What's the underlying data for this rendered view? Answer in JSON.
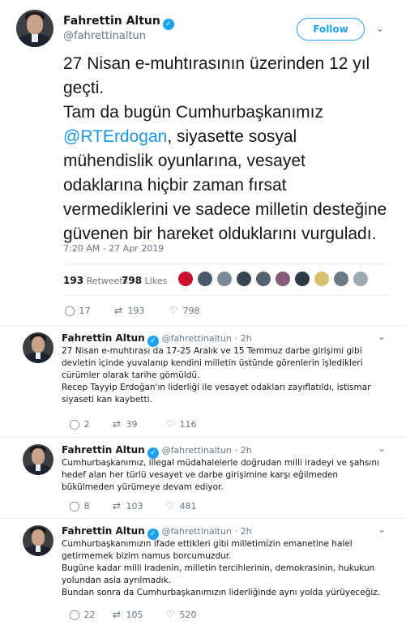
{
  "main_tweet": {
    "author_name": "Fahrettin Altun",
    "handle": "@fahrettinaltun",
    "follow_label": "Follow",
    "text_line1": "27 Nisan e-muhtırasının üzerinden 12 yıl geçti.",
    "text_line2_prefix": "Tam da bugün Cumhurbaşkanımız ",
    "mention": "@RTErdogan",
    "text_line2_suffix": ", siyasette sosyal mühendislik oyunlarına, vesayet odaklarına hiçbir zaman fırsat vermediklerini ve sadece milletin desteğine güvenen bir hareket olduklarını vurguladı.",
    "timestamp": "7:20 AM - 27 Apr 2019",
    "retweets_count": "193",
    "retweets_label": "Retweets",
    "likes_count": "798",
    "likes_label": "Likes",
    "replies": "17",
    "retweets": "193",
    "likes": "798"
  },
  "replies": [
    {
      "author_name": "Fahrettin Altun",
      "handle": "@fahrettinaltun",
      "time": "· 2h",
      "lines": [
        "27 Nisan e-muhtırası da 17-25 Aralık ve 15 Temmuz darbe girişimi gibi devletin içinde yuvalanıp kendini milletin üstünde görenlerin işledikleri cürümler olarak tarihe gömüldü.",
        "Recep Tayyip Erdoğan'ın liderliği ile vesayet odakları zayıflatıldı, istismar siyaseti kan kaybetti."
      ],
      "replies": "2",
      "retweets": "39",
      "likes": "116"
    },
    {
      "author_name": "Fahrettin Altun",
      "handle": "@fahrettinaltun",
      "time": "· 2h",
      "lines": [
        "Cumhurbaşkanımız, illegal müdahalelerle doğrudan milli iradeyi ve şahsını hedef alan her türlü vesayet ve darbe girişimine karşı eğilmeden bükülmeden yürümeye devam ediyor."
      ],
      "replies": "8",
      "retweets": "103",
      "likes": "481"
    },
    {
      "author_name": "Fahrettin Altun",
      "handle": "@fahrettinaltun",
      "time": "· 2h",
      "lines": [
        "Cumhurbaşkanımızın ifade ettikleri gibi milletimizin emanetine halel getirmemek bizim namus borcumuzdur.",
        "Bugüne kadar milli iradenin, milletin tercihlerinin, demokrasinin, hukukun yolundan asla ayrılmadık.",
        "Bundan sonra da Cumhurbaşkanımızın liderliğinde aynı yolda yürüyeceğiz."
      ],
      "replies": "22",
      "retweets": "105",
      "likes": "520"
    }
  ],
  "icons": {
    "verified": "verified-badge-icon",
    "chevron": "chevron-down-icon",
    "reply": "reply-icon",
    "retweet": "retweet-icon",
    "like": "heart-icon"
  },
  "colors": {
    "accent": "#1da1f2",
    "mention": "#1b95e0",
    "muted": "#657786",
    "divider": "#e6ecf0"
  }
}
